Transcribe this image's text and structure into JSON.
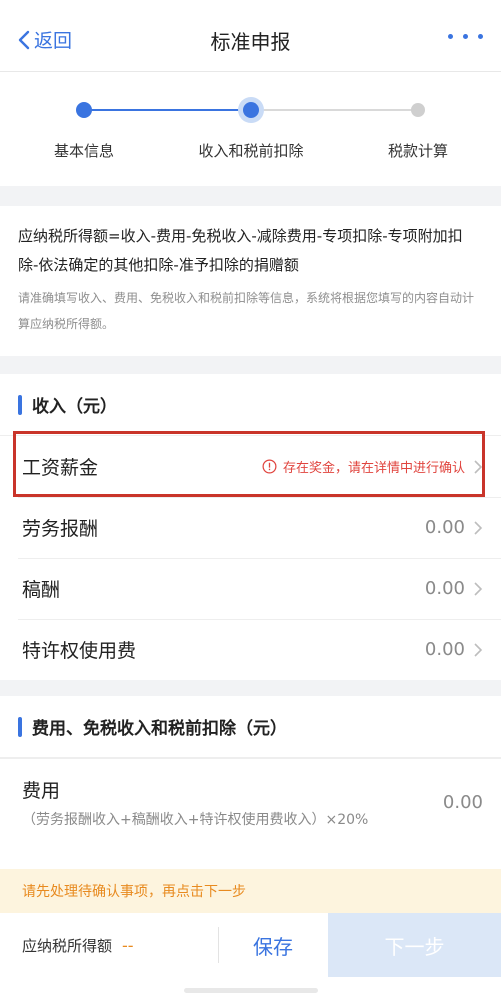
{
  "nav": {
    "back_label": "返回",
    "title": "标准申报"
  },
  "steps": [
    {
      "label": "基本信息"
    },
    {
      "label": "收入和税前扣除"
    },
    {
      "label": "税款计算"
    }
  ],
  "formula": {
    "main": "应纳税所得额=收入-费用-免税收入-减除费用-专项扣除-专项附加扣除-依法确定的其他扣除-准予扣除的捐赠额",
    "sub": "请准确填写收入、费用、免税收入和税前扣除等信息，系统将根据您填写的内容自动计算应纳税所得额。"
  },
  "income": {
    "title": "收入（元）",
    "rows": [
      {
        "name": "工资薪金",
        "warning": "存在奖金，请在详情中进行确认"
      },
      {
        "name": "劳务报酬",
        "value": "0.00"
      },
      {
        "name": "稿酬",
        "value": "0.00"
      },
      {
        "name": "特许权使用费",
        "value": "0.00"
      }
    ]
  },
  "fees": {
    "title": "费用、免税收入和税前扣除（元）",
    "fee_name": "费用",
    "fee_desc": "（劳务报酬收入+稿酬收入+特许权使用费收入）×20%",
    "fee_value": "0.00"
  },
  "notice": "请先处理待确认事项，再点击下一步",
  "bottom": {
    "tax_label": "应纳税所得额",
    "tax_value": "--",
    "save_label": "保存",
    "next_label": "下一步"
  },
  "colors": {
    "accent": "#3a74e0",
    "warning": "#e0443e",
    "notice": "#e88a1f",
    "highlight_box": "#c9342a"
  }
}
